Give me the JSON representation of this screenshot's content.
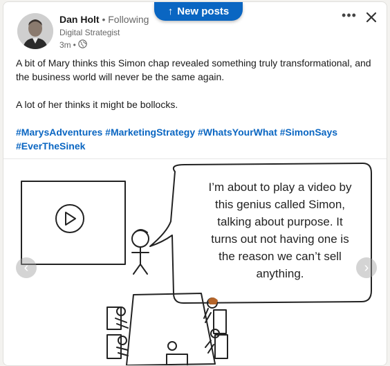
{
  "new_posts": {
    "label": "New posts",
    "icon": "arrow-up-icon"
  },
  "post": {
    "author": {
      "name": "Dan Holt",
      "separator": "•",
      "following": "Following",
      "headline": "Digital Strategist"
    },
    "time": "3m",
    "time_separator": "•",
    "visibility_icon": "globe-icon",
    "body": [
      "A bit of Mary thinks this Simon chap revealed something truly transformational, and the business world will never be the same again.",
      "A lot of her thinks it might be bollocks."
    ],
    "hashtags": [
      "#MarysAdventures",
      "#MarketingStrategy",
      "#WhatsYourWhat",
      "#SimonSays",
      "#EverTheSinek"
    ],
    "image": {
      "speech_lines": [
        "I’m about to play a video by",
        "this genius called Simon,",
        "talking about purpose. It",
        "turns out not having one is",
        "the reason we can’t sell",
        "anything."
      ],
      "prev_icon": "chevron-left-icon",
      "next_icon": "chevron-right-icon"
    }
  },
  "controls": {
    "more_icon": "more-icon",
    "close_icon": "close-icon"
  },
  "colors": {
    "brand": "#0a66c2",
    "text": "#191919",
    "muted": "#666666"
  }
}
